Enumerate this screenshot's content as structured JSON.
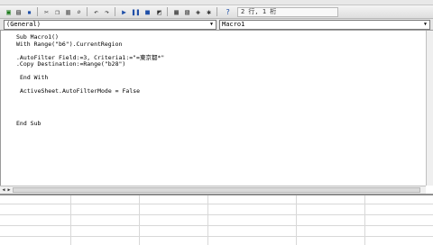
{
  "toolbar": {
    "position_text": "2 行, 1 桁"
  },
  "object_combo": {
    "value": "(General)"
  },
  "procedure_combo": {
    "value": "Macro1"
  },
  "code": {
    "lines": [
      "Sub Macro1()",
      "With Range(\"b6\").CurrentRegion",
      "",
      ".AutoFilter Field:=3, Criteria1:=\"=東京都*\"",
      ".Copy Destination:=Range(\"b28\")",
      "",
      "End With",
      "",
      "ActiveSheet.AutoFilterMode = False",
      "",
      "",
      "",
      "End Sub"
    ]
  }
}
